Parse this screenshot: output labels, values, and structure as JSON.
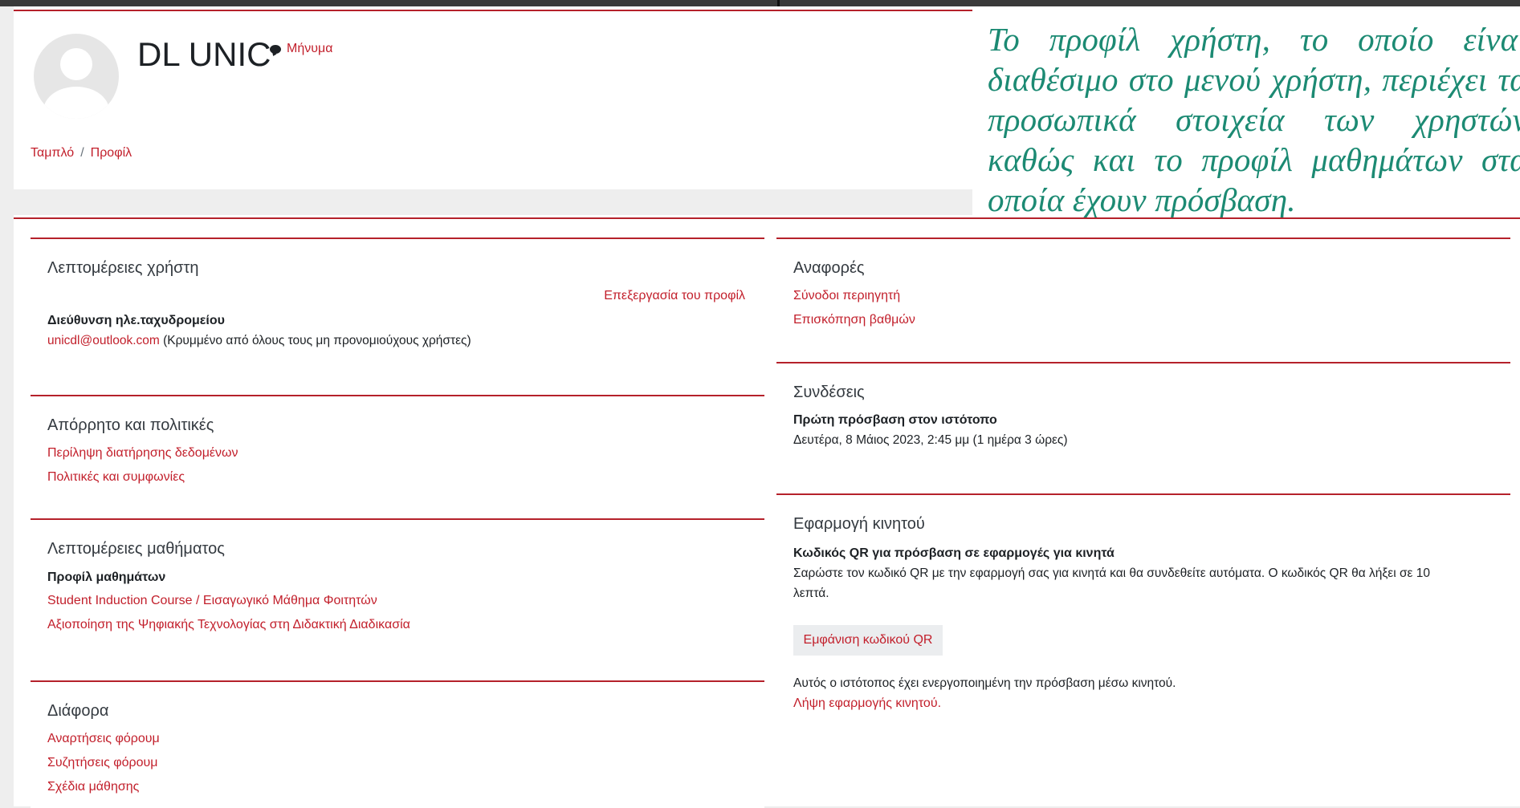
{
  "header": {
    "user_name": "DL UNIC",
    "message_label": "Μήνυμα",
    "breadcrumb": [
      "Ταμπλό",
      "Προφίλ"
    ],
    "breadcrumb_separator": "/"
  },
  "callout": {
    "text": "Το προφίλ χρήστη, το οποίο είναι διαθέσιμο στο μενού χρήστη, περιέχει τα προσωπικά στοιχεία των χρηστών καθώς και το προφίλ μαθημάτων στα οποία έχουν πρόσβαση.",
    "color": "#1c8a73"
  },
  "user_details": {
    "title": "Λεπτομέρειες χρήστη",
    "edit_link": "Επεξεργασία του προφίλ",
    "email_label": "Διεύθυνση ηλε.ταχυδρομείου",
    "email_value": "unicdl@outlook.com",
    "email_note": " (Κρυμμένο από όλους τους μη προνομιούχους χρήστες)"
  },
  "privacy": {
    "title": "Απόρρητο και πολιτικές",
    "links": [
      "Περίληψη διατήρησης δεδομένων",
      "Πολιτικές και συμφωνίες"
    ]
  },
  "course_details": {
    "title": "Λεπτομέρειες μαθήματος",
    "label": "Προφίλ μαθημάτων",
    "courses": [
      "Student Induction Course / Εισαγωγικό Μάθημα Φοιτητών",
      "Αξιοποίηση της Ψηφιακής Τεχνολογίας στη Διδακτική Διαδικασία"
    ]
  },
  "misc": {
    "title": "Διάφορα",
    "links": [
      "Αναρτήσεις φόρουμ",
      "Συζητήσεις φόρουμ",
      "Σχέδια μάθησης"
    ]
  },
  "reports": {
    "title": "Αναφορές",
    "links": [
      "Σύνοδοι περιηγητή",
      "Επισκόπηση βαθμών"
    ]
  },
  "logins": {
    "title": "Συνδέσεις",
    "label": "Πρώτη πρόσβαση στον ιστότοπο",
    "value": "Δευτέρα, 8 Μάιος 2023, 2:45 μμ  (1 ημέρα 3 ώρες)"
  },
  "mobile_app": {
    "title": "Εφαρμογή κινητού",
    "label": "Κωδικός QR για πρόσβαση σε εφαρμογές για κινητά",
    "description_line1": "Σαρώστε τον κωδικό QR με την εφαρμογή σας για κινητά και θα συνδεθείτε αυτόματα. Ο κωδικός QR θα λήξει σε 10",
    "description_line2": "λεπτά.",
    "button_label": "Εμφάνιση κωδικού QR",
    "status_text": "Αυτός ο ιστότοπος έχει ενεργοποιημένη την πρόσβαση μέσω κινητού.",
    "download_link": "Λήψη εφαρμογής κινητού."
  },
  "colors": {
    "accent": "#b5212b",
    "link": "#c21f2b"
  }
}
